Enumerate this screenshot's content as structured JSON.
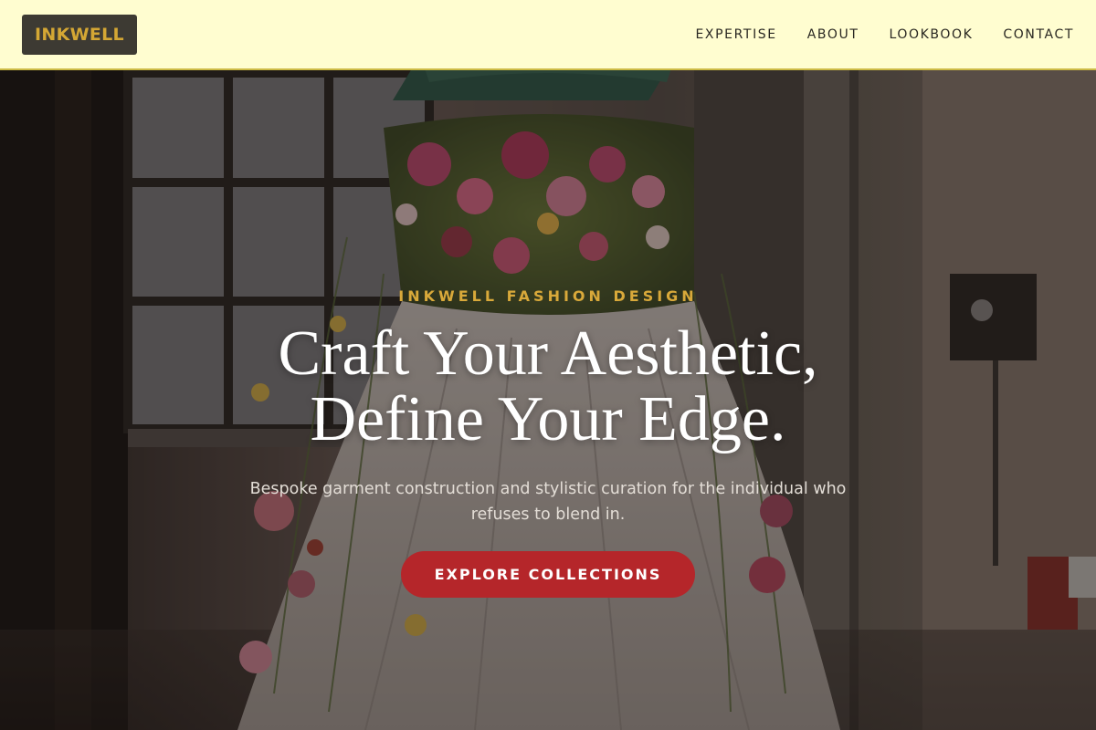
{
  "header": {
    "logo_text": "INKWELL",
    "nav": [
      {
        "label": "EXPERTISE"
      },
      {
        "label": "ABOUT"
      },
      {
        "label": "LOOKBOOK"
      },
      {
        "label": "CONTACT"
      }
    ]
  },
  "hero": {
    "eyebrow": "INKWELL FASHION DESIGN",
    "headline_line1": "Craft Your Aesthetic,",
    "headline_line2": "Define Your Edge.",
    "subtitle": "Bespoke garment construction and stylistic curation for the individual who refuses to blend in.",
    "cta_label": "EXPLORE COLLECTIONS",
    "background_image": "floral-dress-form-in-industrial-studio"
  },
  "colors": {
    "header_bg": "#fffdd0",
    "header_border": "#cdbb45",
    "logo_bg": "#3d3a33",
    "logo_text": "#d4a734",
    "eyebrow": "#d9a93a",
    "cta_bg": "#b5262a"
  }
}
